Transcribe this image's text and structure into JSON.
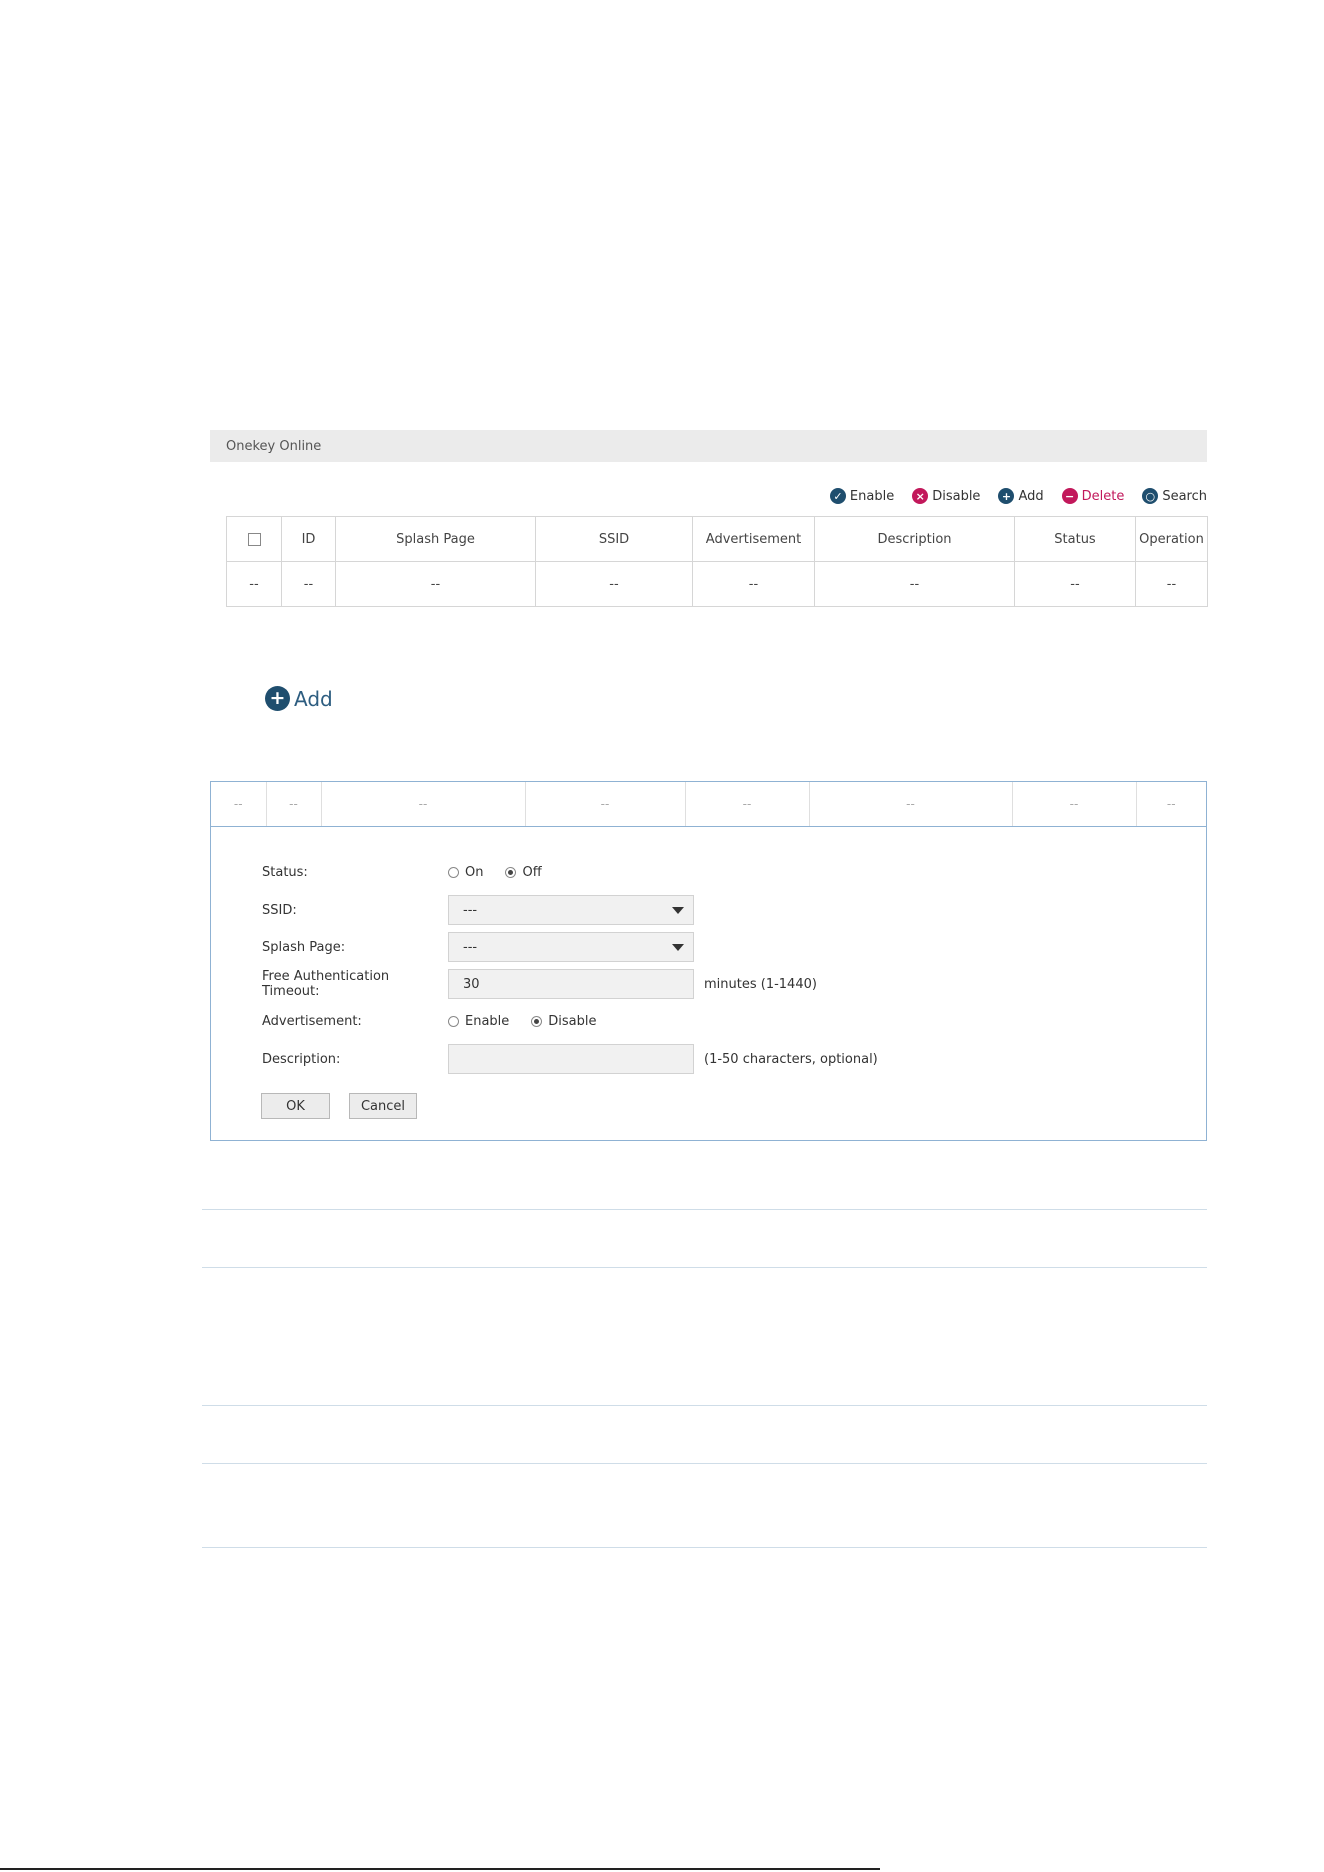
{
  "panel": {
    "title": "Onekey Online"
  },
  "toolbar": {
    "enable": "Enable",
    "disable": "Disable",
    "add": "Add",
    "delete": "Delete",
    "search": "Search"
  },
  "colors": {
    "enable": "#1f4e6e",
    "disable": "#c2185b",
    "add": "#1f4e6e",
    "delete": "#c2185b",
    "search": "#1f4e6e"
  },
  "icons": {
    "enable": "check-circle-icon",
    "disable": "x-circle-icon",
    "add": "plus-circle-icon",
    "delete": "minus-circle-icon",
    "search": "search-icon"
  },
  "table": {
    "columns": [
      "ID",
      "Splash Page",
      "SSID",
      "Advertisement",
      "Description",
      "Status",
      "Operation"
    ],
    "row": [
      "--",
      "--",
      "--",
      "--",
      "--",
      "--",
      "--",
      "--"
    ]
  },
  "add_button": {
    "label": "Add"
  },
  "editor": {
    "row": [
      "--",
      "--",
      "--",
      "--",
      "--",
      "--",
      "--",
      "--"
    ],
    "status": {
      "label": "Status:",
      "on": "On",
      "off": "Off",
      "selected": "Off"
    },
    "ssid": {
      "label": "SSID:",
      "value": "---"
    },
    "splash_page": {
      "label": "Splash Page:",
      "value": "---"
    },
    "free_auth_timeout": {
      "label": "Free Authentication Timeout:",
      "value": "30",
      "hint": "minutes (1-1440)"
    },
    "advertisement": {
      "label": "Advertisement:",
      "enable": "Enable",
      "disable": "Disable",
      "selected": "Disable"
    },
    "description": {
      "label": "Description:",
      "value": "",
      "hint": "(1-50 characters, optional)"
    },
    "ok": "OK",
    "cancel": "Cancel"
  }
}
